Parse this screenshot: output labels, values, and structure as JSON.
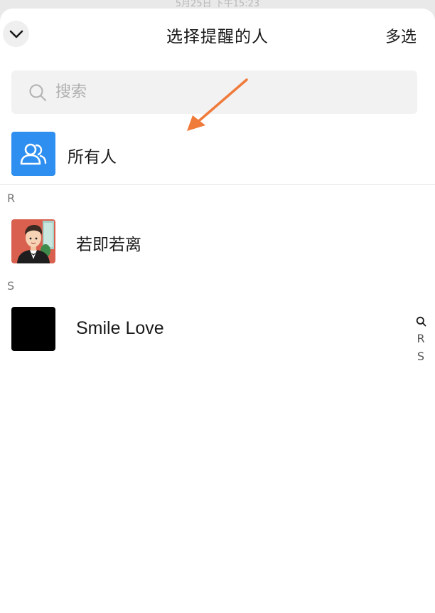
{
  "status_bar": {
    "time_text": "5月25日 下午15:23"
  },
  "header": {
    "title": "选择提醒的人",
    "multi_select_label": "多选"
  },
  "search": {
    "placeholder": "搜索",
    "value": ""
  },
  "everyone": {
    "label": "所有人",
    "icon": "group-icon",
    "color": "#2f8ff0"
  },
  "sections": [
    {
      "letter": "R",
      "contacts": [
        {
          "name": "若即若离",
          "avatar": "cartoon-man-avatar"
        }
      ]
    },
    {
      "letter": "S",
      "contacts": [
        {
          "name": "Smile Love",
          "avatar": "black-avatar"
        }
      ]
    }
  ],
  "index_bar": {
    "items": [
      "R",
      "S"
    ],
    "search_icon": "search-icon"
  },
  "annotation": {
    "arrow_color": "#f07a3a"
  }
}
